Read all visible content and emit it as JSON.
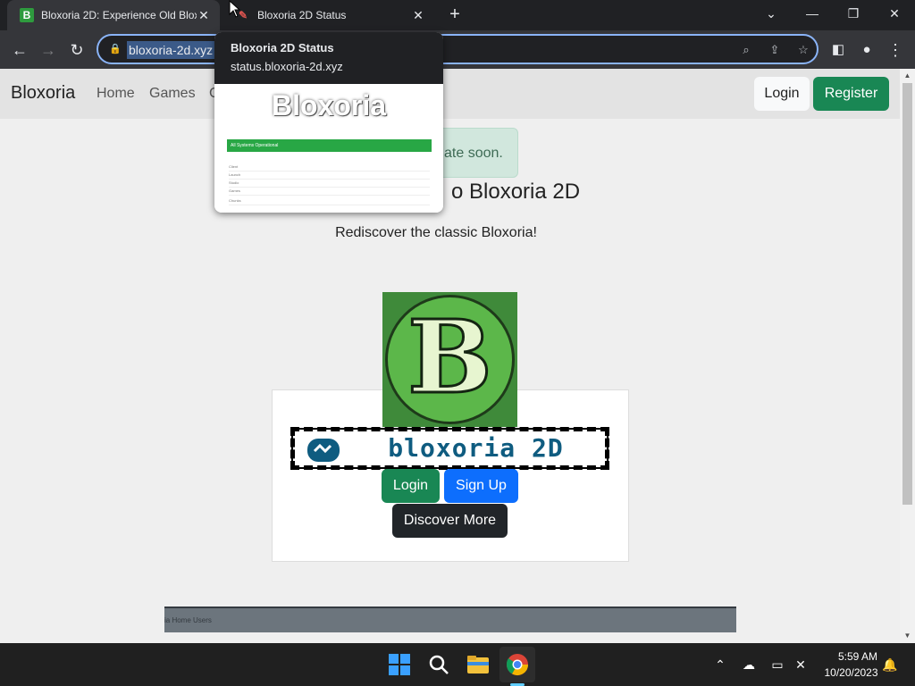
{
  "browser": {
    "tabs": [
      {
        "title": "Bloxoria 2D: Experience Old Blox",
        "favicon_letter": "B",
        "active": true
      },
      {
        "title": "Bloxoria 2D Status",
        "active": false
      }
    ],
    "url": "bloxoria-2d.xyz",
    "new_tab_symbol": "+"
  },
  "hover_card": {
    "title": "Bloxoria 2D Status",
    "url": "status.bloxoria-2d.xyz",
    "preview": {
      "logo": "Bloxoria",
      "status_text": "All Systems Operational",
      "rows": [
        "Client",
        "Launch",
        "Studio",
        "Games",
        "Chunks"
      ]
    }
  },
  "site": {
    "brand": "Bloxoria",
    "nav": [
      "Home",
      "Games",
      "C"
    ],
    "login": "Login",
    "register": "Register",
    "alert_text": "ate soon.",
    "heading": "o Bloxoria 2D",
    "subtitle": "Rediscover the classic Bloxoria!",
    "logo_letter": "B",
    "banner_text": "bloxoria 2D",
    "card_buttons": {
      "login": "Login",
      "signup": "Sign Up",
      "discover": "Discover More"
    },
    "footer_crumbs": "ia   Home   Users"
  },
  "taskbar": {
    "time": "5:59 AM",
    "date": "10/20/2023"
  },
  "colors": {
    "register_green": "#198754",
    "signup_blue": "#0d6efd",
    "discover_dark": "#212529",
    "omnibox_focus": "#8ab4f8"
  }
}
